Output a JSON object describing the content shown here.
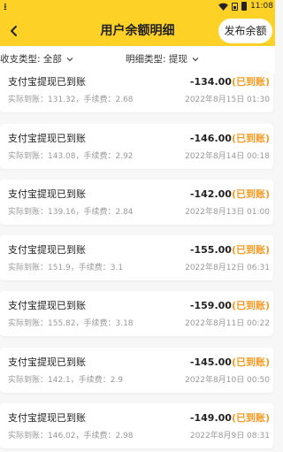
{
  "status_bar": {
    "time": "11:08"
  },
  "header": {
    "title": "用户余额明细",
    "publish_label": "发布余额"
  },
  "filters": {
    "income_type_label": "收支类型:",
    "income_type_value": "全部",
    "detail_type_label": "明细类型:",
    "detail_type_value": "提现"
  },
  "records": [
    {
      "title": "支付宝提现已到账",
      "amount": "-134.00",
      "status": "(已到账)",
      "detail": "实际到账：131.32，手续费：2.68",
      "date": "2022年8月15日 01:30"
    },
    {
      "title": "支付宝提现已到账",
      "amount": "-146.00",
      "status": "(已到账)",
      "detail": "实际到账：143.08，手续费：2.92",
      "date": "2022年8月14日 00:18"
    },
    {
      "title": "支付宝提现已到账",
      "amount": "-142.00",
      "status": "(已到账)",
      "detail": "实际到账：139.16，手续费：2.84",
      "date": "2022年8月13日 01:00"
    },
    {
      "title": "支付宝提现已到账",
      "amount": "-155.00",
      "status": "(已到账)",
      "detail": "实际到账：151.9，手续费：3.1",
      "date": "2022年8月12日 06:31"
    },
    {
      "title": "支付宝提现已到账",
      "amount": "-159.00",
      "status": "(已到账)",
      "detail": "实际到账：155.82，手续费：3.18",
      "date": "2022年8月11日 00:22"
    },
    {
      "title": "支付宝提现已到账",
      "amount": "-145.00",
      "status": "(已到账)",
      "detail": "实际到账：142.1，手续费：2.9",
      "date": "2022年8月10日 00:50"
    },
    {
      "title": "支付宝提现已到账",
      "amount": "-149.00",
      "status": "(已到账)",
      "detail": "实际到账：146.02，手续费：2.98",
      "date": "2022年8月9日 08:31"
    }
  ],
  "colors": {
    "brand_yellow": "#fdd125",
    "status_orange": "#f59a23"
  }
}
